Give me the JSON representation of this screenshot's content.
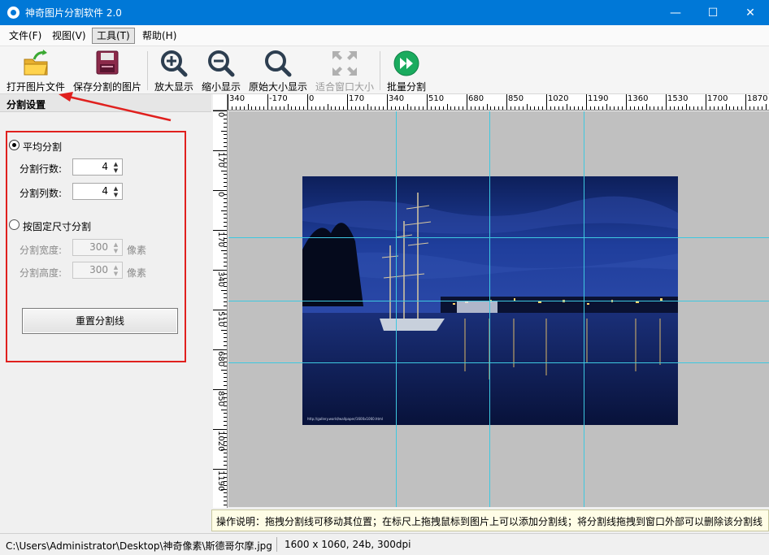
{
  "window": {
    "title": "神奇图片分割软件 2.0"
  },
  "menu": [
    "文件(F)",
    "视图(V)",
    "工具(T)",
    "帮助(H)"
  ],
  "toolbar": {
    "open": "打开图片文件",
    "save": "保存分割的图片",
    "zoom_in": "放大显示",
    "zoom_out": "缩小显示",
    "original": "原始大小显示",
    "fit": "适合窗口大小",
    "batch": "批量分割"
  },
  "panel": {
    "title": "分割设置",
    "even_split": "平均分割",
    "rows_label": "分割行数:",
    "rows_value": "4",
    "cols_label": "分割列数:",
    "cols_value": "4",
    "fixed_split": "按固定尺寸分割",
    "width_label": "分割宽度:",
    "width_value": "300",
    "height_label": "分割高度:",
    "height_value": "300",
    "unit": "像素",
    "reset_button": "重置分割线"
  },
  "rulers": {
    "top": [
      "340",
      "-170",
      "0",
      "170",
      "340",
      "510",
      "680",
      "850",
      "1020",
      "1190",
      "1360",
      "1530",
      "1700",
      "1870"
    ],
    "left": [
      "0",
      "170",
      "0",
      "170",
      "340",
      "510",
      "680",
      "850",
      "1020",
      "1190",
      "13"
    ]
  },
  "photo": {
    "watermark": "http://gallery.world/wallpaper/1600x1060.html"
  },
  "hint": "操作说明：拖拽分割线可移动其位置；在标尺上拖拽鼠标到图片上可以添加分割线；将分割线拖拽到窗口外部可以删除该分割线",
  "status": {
    "path": "C:\\Users\\Administrator\\Desktop\\神奇像素\\斯德哥尔摩.jpg",
    "info": "1600 x 1060, 24b, 300dpi"
  }
}
